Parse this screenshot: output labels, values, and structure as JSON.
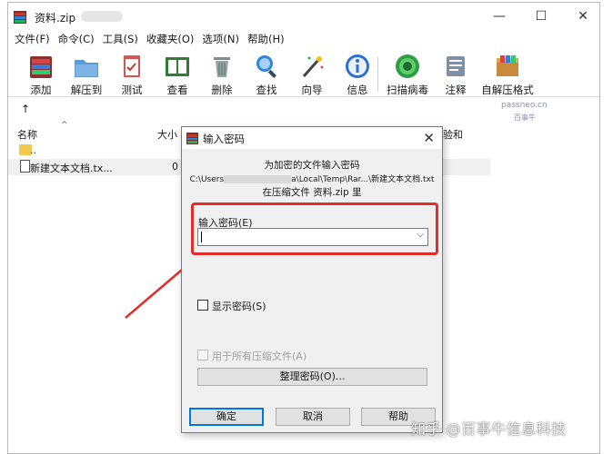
{
  "window": {
    "title": "资料.zip",
    "controls": {
      "minimize": "—",
      "maximize": "☐",
      "close": "✕"
    }
  },
  "menu": [
    "文件(F)",
    "命令(C)",
    "工具(S)",
    "收藏夹(O)",
    "选项(N)",
    "帮助(H)"
  ],
  "toolbar": [
    {
      "label": "添加",
      "icon": "add-archive-icon"
    },
    {
      "label": "解压到",
      "icon": "extract-to-icon"
    },
    {
      "label": "测试",
      "icon": "test-icon"
    },
    {
      "label": "查看",
      "icon": "view-icon"
    },
    {
      "label": "删除",
      "icon": "delete-icon"
    },
    {
      "label": "查找",
      "icon": "find-icon"
    },
    {
      "label": "向导",
      "icon": "wizard-icon"
    },
    {
      "label": "信息",
      "icon": "info-icon"
    },
    {
      "label": "扫描病毒",
      "icon": "virus-scan-icon"
    },
    {
      "label": "注释",
      "icon": "comment-icon"
    },
    {
      "label": "自解压格式",
      "icon": "sfx-icon"
    }
  ],
  "watermark_top": {
    "line1": "passneo.cn",
    "line2": "百事牛"
  },
  "file_list": {
    "headers": {
      "name": "名称",
      "size": "大小",
      "checksum": "验和"
    },
    "rows": [
      {
        "name": "..",
        "size": "",
        "type": "folder"
      },
      {
        "name": "新建文本文档.tx...",
        "size": "0",
        "type": "file"
      }
    ]
  },
  "dialog": {
    "title": "输入密码",
    "close": "✕",
    "info_line1": "为加密的文件输入密码",
    "path_prefix": "C:\\Users",
    "path_suffix": "a\\Local\\Temp\\Rar...\\新建文本文档.txt",
    "info_line3": "在压缩文件 资料.zip 里",
    "password_label": "输入密码(E)",
    "password_value": "",
    "show_password_label": "显示密码(S)",
    "use_for_all_label": "用于所有压缩文件(A)",
    "organize_button": "整理密码(O)...",
    "ok_button": "确定",
    "cancel_button": "取消",
    "help_button": "帮助"
  },
  "colors": {
    "highlight": "#e22d2d",
    "default_button_border": "#0078d7"
  },
  "watermark_bottom": "知乎 @百事牛信息科技"
}
